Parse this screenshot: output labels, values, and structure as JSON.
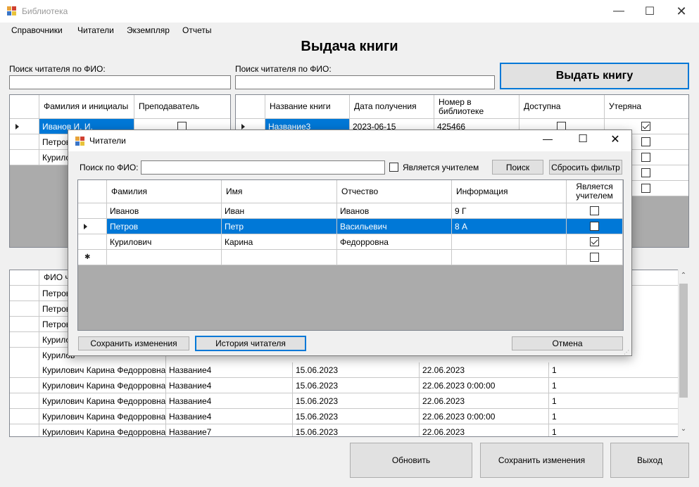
{
  "window": {
    "title": "Библиотека"
  },
  "menu": [
    "Справочники",
    "Читатели",
    "Экземпляр",
    "Отчеты"
  ],
  "page_title": "Выдача книги",
  "search_left": {
    "label": "Поиск читателя по ФИО:",
    "value": ""
  },
  "search_right": {
    "label": "Поиск читателя по ФИО:",
    "value": ""
  },
  "issue_button": "Выдать книгу",
  "readers_grid": {
    "headers": [
      "Фамилия и инициалы",
      "Преподаватель"
    ],
    "rows": [
      {
        "name": "Иванов И. И.",
        "teacher": false
      },
      {
        "name": "Петров",
        "teacher": false
      },
      {
        "name": "Курилов",
        "teacher": false
      }
    ]
  },
  "books_grid": {
    "headers": [
      "Название книги",
      "Дата получения",
      "Номер в библиотеке",
      "Доступна",
      "Утеряна"
    ],
    "rows": [
      {
        "title": "Название3",
        "date": "2023-06-15",
        "number": "425466",
        "available": false,
        "lost": true
      }
    ],
    "extra_lost_checks": [
      false,
      false,
      false,
      false
    ]
  },
  "history_grid": {
    "header_first": "ФИО ч",
    "partial_rows": [
      "Петров",
      "Петров",
      "Петров",
      "Курилов",
      "Курилов"
    ],
    "rows": [
      {
        "fio": "Курилович Карина Федорровна",
        "book": "Название4",
        "date_from": "15.06.2023",
        "date_to": "22.06.2023",
        "count": "1"
      },
      {
        "fio": "Курилович Карина Федорровна",
        "book": "Название4",
        "date_from": "15.06.2023",
        "date_to": "22.06.2023 0:00:00",
        "count": "1"
      },
      {
        "fio": "Курилович Карина Федорровна",
        "book": "Название4",
        "date_from": "15.06.2023",
        "date_to": "22.06.2023",
        "count": "1"
      },
      {
        "fio": "Курилович Карина Федорровна",
        "book": "Название4",
        "date_from": "15.06.2023",
        "date_to": "22.06.2023 0:00:00",
        "count": "1"
      },
      {
        "fio": "Курилович Карина Федорровна",
        "book": "Название7",
        "date_from": "15.06.2023",
        "date_to": "22.06.2023",
        "count": "1"
      }
    ]
  },
  "bottom_buttons": {
    "refresh": "Обновить",
    "save": "Сохранить изменения",
    "exit": "Выход"
  },
  "dialog": {
    "title": "Читатели",
    "search_label": "Поиск по ФИО:",
    "search_value": "",
    "is_teacher_label": "Является учителем",
    "search_button": "Поиск",
    "reset_button": "Сбросить фильтр",
    "headers": [
      "Фамилия",
      "Имя",
      "Отчество",
      "Информация",
      "Является учителем"
    ],
    "rows": [
      {
        "last": "Иванов",
        "first": "Иван",
        "middle": "Иванов",
        "info": "9 Г",
        "teacher": false,
        "selected": false
      },
      {
        "last": "Петров",
        "first": "Петр",
        "middle": "Васильевич",
        "info": "8 А",
        "teacher": false,
        "selected": true
      },
      {
        "last": "Курилович",
        "first": "Карина",
        "middle": "Федорровна",
        "info": "",
        "teacher": true,
        "selected": false
      }
    ],
    "save_button": "Сохранить изменения",
    "history_button": "История читателя",
    "cancel_button": "Отмена"
  },
  "colors": {
    "selection": "#0078d7",
    "grid_background": "#ababab",
    "button": "#e1e1e1"
  }
}
